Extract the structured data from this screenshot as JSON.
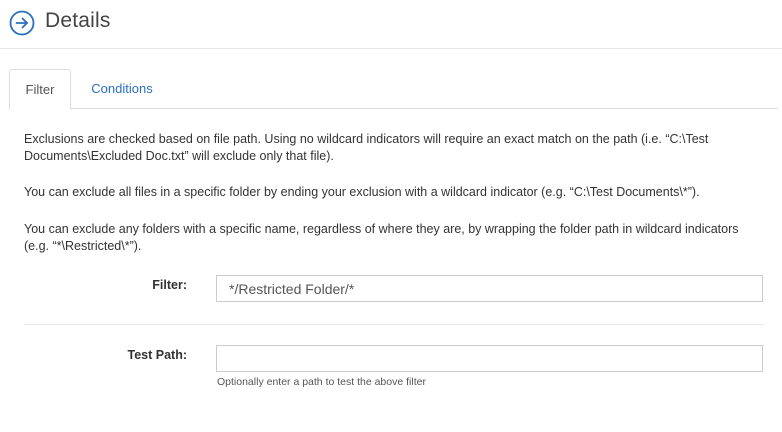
{
  "header": {
    "icon": "circle-arrow-right-icon",
    "title": "Details",
    "accent_color": "#2a6fbf"
  },
  "tabs": [
    {
      "label": "Filter",
      "active": true
    },
    {
      "label": "Conditions",
      "active": false
    }
  ],
  "description": {
    "paragraph1": "Exclusions are checked based on file path. Using no wildcard indicators will require an exact match on the path (i.e. “C:\\Test Documents\\Excluded Doc.txt” will exclude only that file).",
    "paragraph2": "You can exclude all files in a specific folder by ending your exclusion with a wildcard indicator (e.g. “C:\\Test Documents\\*”).",
    "paragraph3": "You can exclude any folders with a specific name, regardless of where they are, by wrapping the folder path in wildcard indicators (e.g. “*\\Restricted\\*”)."
  },
  "form": {
    "filter_label": "Filter:",
    "filter_value": "*/Restricted Folder/*",
    "test_path_label": "Test Path:",
    "test_path_value": "",
    "test_path_help": "Optionally enter a path to test the above filter"
  }
}
